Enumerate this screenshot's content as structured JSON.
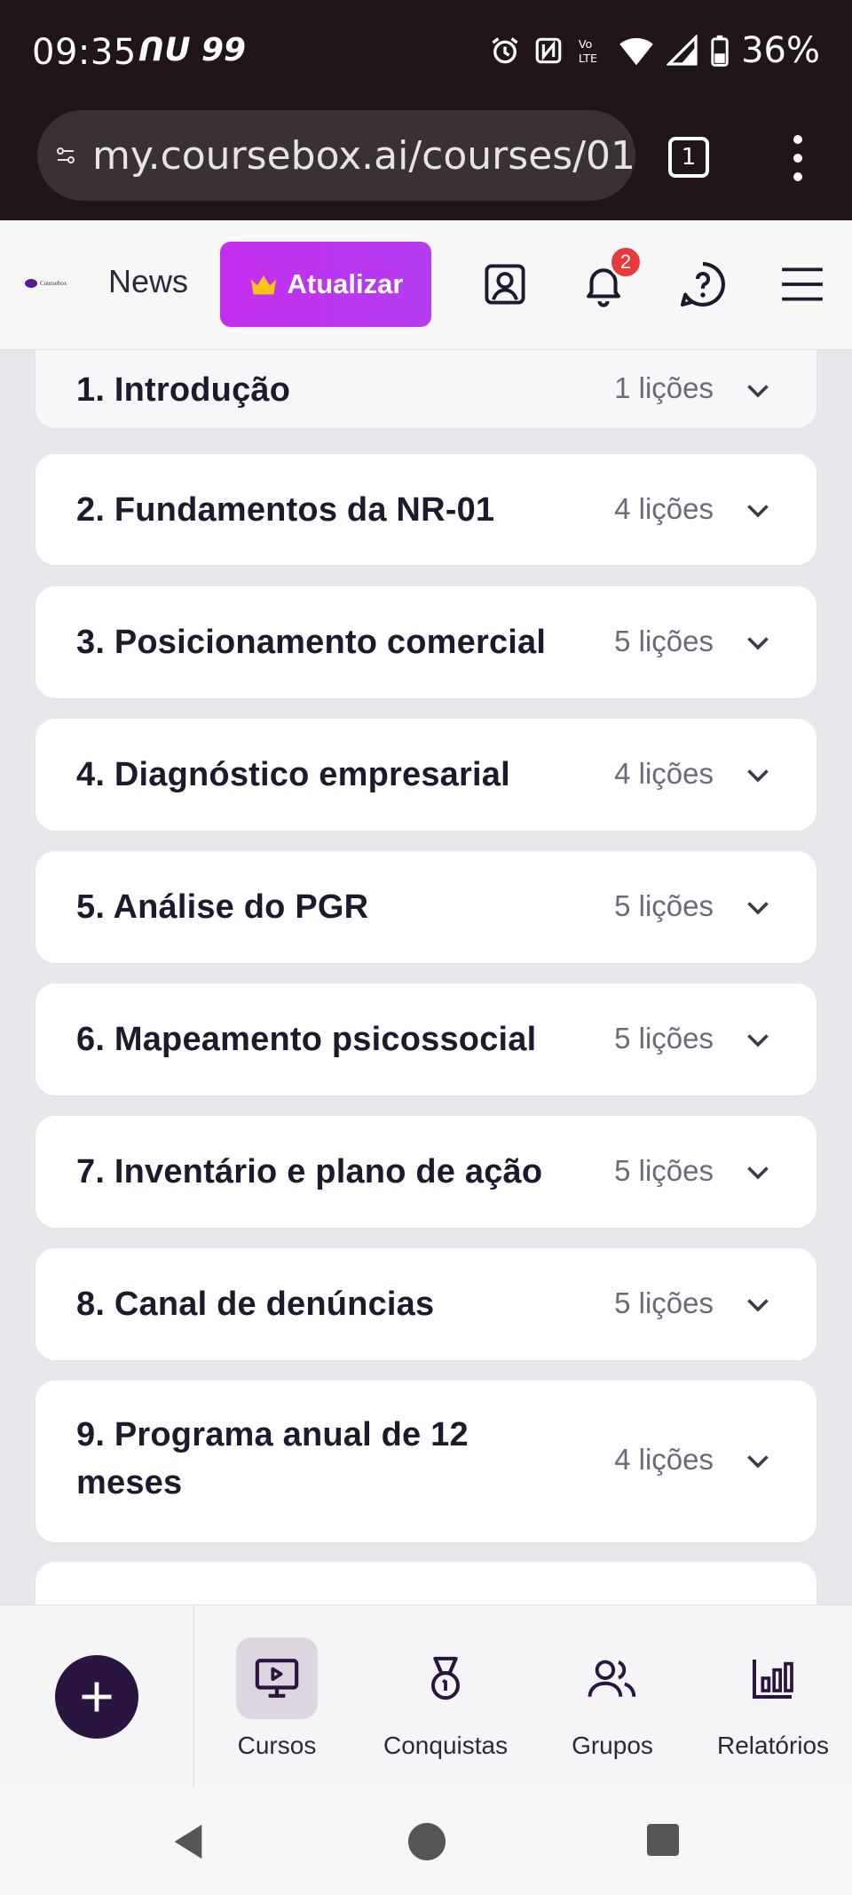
{
  "status_bar": {
    "time": "09:35",
    "extra": "ᑎᑌ 99",
    "battery": "36%",
    "icons": [
      "alarm-icon",
      "nfc-icon",
      "volte-icon",
      "wifi-icon",
      "signal-icon",
      "battery-icon"
    ]
  },
  "browser": {
    "url": "my.coursebox.ai/courses/01",
    "tab_count": "1"
  },
  "header": {
    "logo_text": "Coursebox",
    "news": "News",
    "upgrade": "Atualizar",
    "notification_count": "2"
  },
  "modules": [
    {
      "title": "1. Introdução",
      "count": "1 lições"
    },
    {
      "title": "2. Fundamentos da NR-01",
      "count": "4 lições"
    },
    {
      "title": "3. Posicionamento comercial",
      "count": "5 lições"
    },
    {
      "title": "4. Diagnóstico empresarial",
      "count": "4 lições"
    },
    {
      "title": "5. Análise do PGR",
      "count": "5 lições"
    },
    {
      "title": "6. Mapeamento psicossocial",
      "count": "5 lições"
    },
    {
      "title": "7. Inventário e plano de ação",
      "count": "5 lições"
    },
    {
      "title": "8. Canal de denúncias",
      "count": "5 lições"
    },
    {
      "title": "9. Programa anual de 12 meses",
      "count": "4 lições"
    }
  ],
  "bottom_nav": {
    "items": [
      {
        "label": "Cursos",
        "icon": "monitor-play-icon",
        "active": true
      },
      {
        "label": "Conquistas",
        "icon": "medal-icon",
        "active": false
      },
      {
        "label": "Grupos",
        "icon": "users-icon",
        "active": false
      },
      {
        "label": "Relatórios",
        "icon": "bar-chart-icon",
        "active": false
      }
    ]
  },
  "colors": {
    "status_bar_bg": "#211617",
    "upgrade_gradient_start": "#c42ef0",
    "fab_bg": "#2a1540",
    "badge": "#e83a3a"
  }
}
